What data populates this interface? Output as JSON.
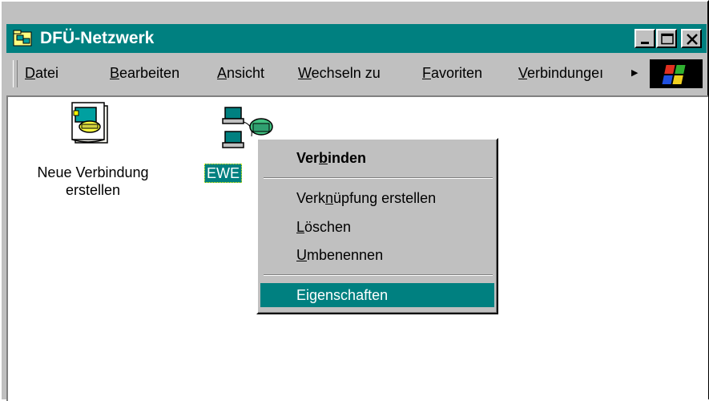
{
  "window": {
    "title": "DFÜ-Netzwerk"
  },
  "menubar": {
    "items": [
      {
        "pre": "",
        "key": "D",
        "post": "atei"
      },
      {
        "pre": "",
        "key": "B",
        "post": "earbeiten"
      },
      {
        "pre": "",
        "key": "A",
        "post": "nsicht"
      },
      {
        "pre": "",
        "key": "W",
        "post": "echseln zu"
      },
      {
        "pre": "",
        "key": "F",
        "post": "avoriten"
      },
      {
        "pre": "",
        "key": "V",
        "post": "erbindungeı"
      }
    ],
    "overflow_icon": "chevron-right-icon"
  },
  "icons": [
    {
      "label": "Neue Verbindung\nerstellen",
      "icon": "new-connection-icon"
    },
    {
      "label": "EWE",
      "icon": "dialup-connection-icon",
      "selected": true
    }
  ],
  "context_menu": {
    "items": [
      {
        "pre": "Ver",
        "key": "b",
        "post": "inden",
        "bold": true
      },
      {
        "separator": true
      },
      {
        "pre": "Verk",
        "key": "n",
        "post": "üpfung erstellen"
      },
      {
        "pre": "",
        "key": "L",
        "post": "öschen"
      },
      {
        "pre": "",
        "key": "U",
        "post": "mbenennen"
      },
      {
        "separator": true
      },
      {
        "pre": "Ei",
        "key": "g",
        "post": "enschaften",
        "selected": true
      }
    ]
  },
  "colors": {
    "title_bar": "#008080",
    "selection": "#008080",
    "face": "#c0c0c0"
  }
}
